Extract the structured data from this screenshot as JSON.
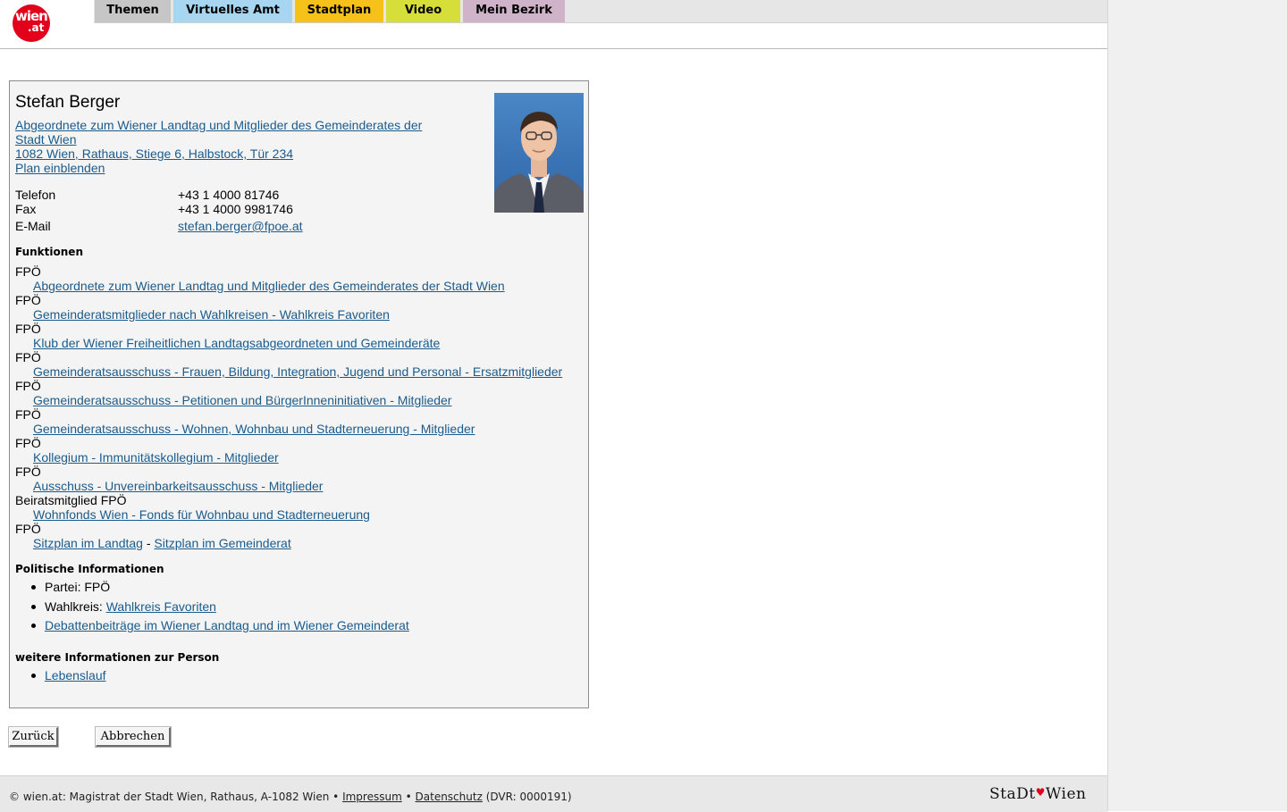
{
  "logo": {
    "line1": "wien",
    "line2": ".at"
  },
  "nav": {
    "tabs": [
      {
        "label": "Themen",
        "color": "#c6c6c6"
      },
      {
        "label": "Virtuelles Amt",
        "color": "#a8d6f0"
      },
      {
        "label": "Stadtplan",
        "color": "#f6c21a"
      },
      {
        "label": "Video",
        "color": "#d6df3a"
      },
      {
        "label": "Mein Bezirk",
        "color": "#cfb3c9"
      }
    ]
  },
  "person": {
    "name": "Stefan Berger",
    "role_link_line1": "Abgeordnete zum Wiener Landtag und Mitglieder des Gemeinderates der",
    "role_link_line2": "Stadt Wien",
    "address_link": "1082 Wien, Rathaus, Stiege 6, Halbstock, Tür 234",
    "plan_link": "Plan einblenden",
    "contact": [
      {
        "label": "Telefon",
        "value": "+43 1 4000 81746"
      },
      {
        "label": "Fax",
        "value": "+43 1 4000 9981746"
      },
      {
        "label": "E-Mail",
        "value": "stefan.berger@fpoe.at"
      }
    ]
  },
  "funktionen": {
    "heading": "Funktionen",
    "items": [
      {
        "party": "FPÖ",
        "link": "Abgeordnete zum Wiener Landtag und Mitglieder des Gemeinderates der Stadt Wien"
      },
      {
        "party": "FPÖ",
        "link": "Gemeinderatsmitglieder nach Wahlkreisen - Wahlkreis Favoriten"
      },
      {
        "party": "FPÖ",
        "link": "Klub der Wiener Freiheitlichen Landtagsabgeordneten und Gemeinderäte"
      },
      {
        "party": "FPÖ",
        "link": "Gemeinderatsausschuss - Frauen, Bildung, Integration, Jugend und Personal - Ersatzmitglieder"
      },
      {
        "party": "FPÖ",
        "link": "Gemeinderatsausschuss - Petitionen und BürgerInneninitiativen - Mitglieder"
      },
      {
        "party": "FPÖ",
        "link": "Gemeinderatsausschuss - Wohnen, Wohnbau und Stadterneuerung - Mitglieder"
      },
      {
        "party": "FPÖ",
        "link": "Kollegium - Immunitätskollegium - Mitglieder"
      },
      {
        "party": "FPÖ",
        "link": "Ausschuss - Unvereinbarkeitsausschuss - Mitglieder"
      },
      {
        "party": "Beiratsmitglied FPÖ",
        "link": "Wohnfonds Wien - Fonds für Wohnbau und Stadterneuerung"
      },
      {
        "party": "FPÖ",
        "link": ""
      }
    ],
    "sitzplan_landtag": "Sitzplan im Landtag",
    "sitzplan_separator": "-",
    "sitzplan_gemeinderat": "Sitzplan im Gemeinderat"
  },
  "politisch": {
    "heading": "Politische Informationen",
    "partei": "Partei: FPÖ",
    "wahlkreis_label": "Wahlkreis:",
    "wahlkreis_link": "Wahlkreis Favoriten",
    "debatten_link": "Debattenbeiträge im Wiener Landtag und im Wiener Gemeinderat"
  },
  "weitere": {
    "heading": "weitere Informationen zur Person",
    "lebenslauf": "Lebenslauf"
  },
  "buttons": {
    "back": "Zurück",
    "cancel": "Abbrechen"
  },
  "footer": {
    "text": "© wien.at: Magistrat der Stadt Wien, Rathaus, A-1082 Wien •",
    "impressum": "Impressum",
    "sep": "•",
    "datenschutz": "Datenschutz",
    "dvr": "(DVR: 0000191)",
    "brand_left": "StaDt",
    "brand_heart": "♥",
    "brand_right": "Wien"
  }
}
